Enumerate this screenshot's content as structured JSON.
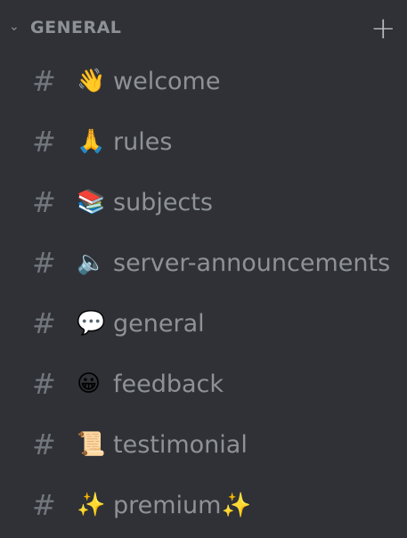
{
  "category": {
    "title": "GENERAL",
    "collapse_icon": "chevron-down-icon",
    "add_icon": "plus-icon"
  },
  "channels": [
    {
      "emoji": "👋",
      "name": "welcome"
    },
    {
      "emoji": "🙏",
      "name": "rules"
    },
    {
      "emoji": "📚",
      "name": "subjects"
    },
    {
      "emoji": "🔈",
      "name": "server-announcements"
    },
    {
      "emoji": "💬",
      "name": "general"
    },
    {
      "emoji": "😀",
      "name": "feedback"
    },
    {
      "emoji": "📜",
      "name": "testimonial"
    },
    {
      "emoji": "✨",
      "name": "premium✨"
    }
  ]
}
